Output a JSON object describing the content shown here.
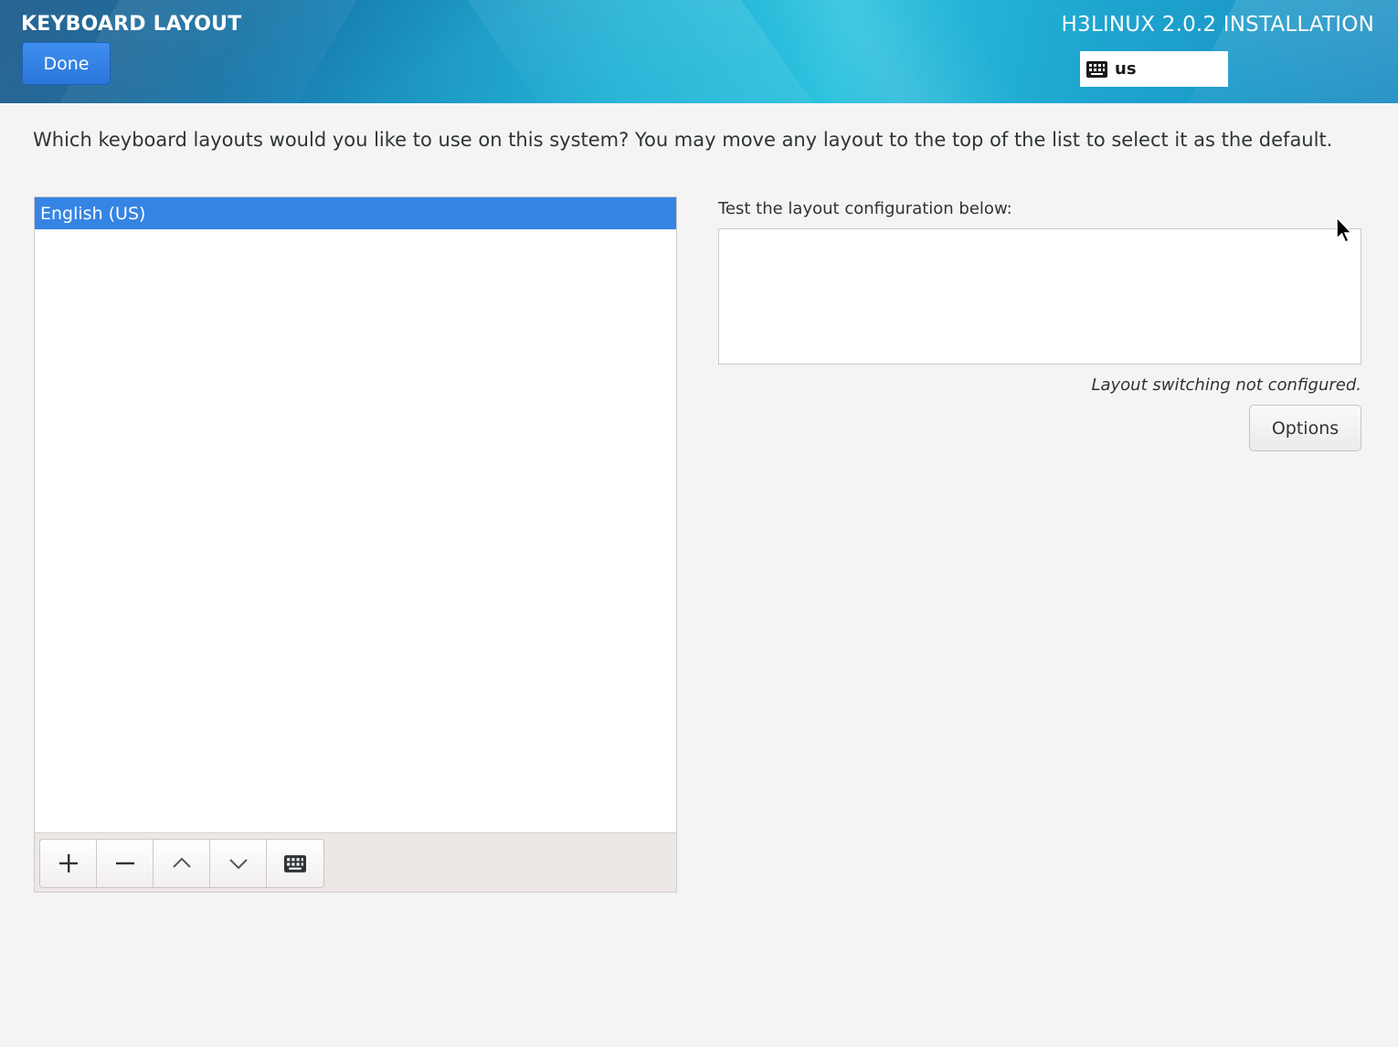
{
  "header": {
    "screen_title": "KEYBOARD LAYOUT",
    "done_label": "Done",
    "product_title": "H3LINUX 2.0.2 INSTALLATION",
    "layout_indicator": {
      "icon": "keyboard-icon",
      "code": "us"
    }
  },
  "main": {
    "prompt": "Which keyboard layouts would you like to use on this system?  You may move any layout to the top of the list to select it as the default.",
    "layouts": [
      {
        "label": "English (US)",
        "selected": true
      }
    ],
    "toolbar": {
      "buttons": [
        {
          "icon": "add-icon"
        },
        {
          "icon": "remove-icon"
        },
        {
          "icon": "move-up-icon"
        },
        {
          "icon": "move-down-icon"
        },
        {
          "icon": "keyboard-preview-icon"
        }
      ]
    },
    "test_label": "Test the layout configuration below:",
    "test_value": "",
    "switch_note": "Layout switching not configured.",
    "options_label": "Options"
  },
  "colors": {
    "accent_selection": "#3584e4",
    "done_button": "#2f7fe3",
    "background": "#f5f4f4"
  }
}
